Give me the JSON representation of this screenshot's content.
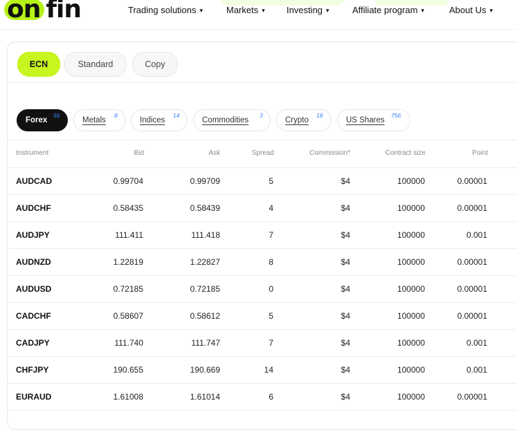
{
  "header": {
    "logo_part1": "on",
    "logo_part2": "fin",
    "nav": [
      {
        "label": "Trading solutions"
      },
      {
        "label": "Markets"
      },
      {
        "label": "Investing"
      },
      {
        "label": "Affiliate program"
      },
      {
        "label": "About Us"
      }
    ],
    "caret": "▾"
  },
  "account_tabs": [
    {
      "label": "ECN",
      "active": true
    },
    {
      "label": "Standard",
      "active": false
    },
    {
      "label": "Copy",
      "active": false
    }
  ],
  "category_tabs": [
    {
      "label": "Forex",
      "count": "56",
      "active": true
    },
    {
      "label": "Metals",
      "count": "8",
      "active": false
    },
    {
      "label": "Indices",
      "count": "14",
      "active": false
    },
    {
      "label": "Commodities",
      "count": "3",
      "active": false
    },
    {
      "label": "Crypto",
      "count": "18",
      "active": false
    },
    {
      "label": "US Shares",
      "count": "756",
      "active": false
    }
  ],
  "table": {
    "columns": [
      "Instrument",
      "Bid",
      "Ask",
      "Spread",
      "Commission*",
      "Contract size",
      "Point"
    ],
    "rows": [
      [
        "AUDCAD",
        "0.99704",
        "0.99709",
        "5",
        "$4",
        "100000",
        "0.00001"
      ],
      [
        "AUDCHF",
        "0.58435",
        "0.58439",
        "4",
        "$4",
        "100000",
        "0.00001"
      ],
      [
        "AUDJPY",
        "111.411",
        "111.418",
        "7",
        "$4",
        "100000",
        "0.001"
      ],
      [
        "AUDNZD",
        "1.22819",
        "1.22827",
        "8",
        "$4",
        "100000",
        "0.00001"
      ],
      [
        "AUDUSD",
        "0.72185",
        "0.72185",
        "0",
        "$4",
        "100000",
        "0.00001"
      ],
      [
        "CADCHF",
        "0.58607",
        "0.58612",
        "5",
        "$4",
        "100000",
        "0.00001"
      ],
      [
        "CADJPY",
        "111.740",
        "111.747",
        "7",
        "$4",
        "100000",
        "0.001"
      ],
      [
        "CHFJPY",
        "190.655",
        "190.669",
        "14",
        "$4",
        "100000",
        "0.001"
      ],
      [
        "EURAUD",
        "1.61008",
        "1.61014",
        "6",
        "$4",
        "100000",
        "0.00001"
      ]
    ]
  },
  "colors": {
    "accent": "#c6f51f",
    "count_blue": "#3b82f6",
    "dark": "#111111"
  }
}
